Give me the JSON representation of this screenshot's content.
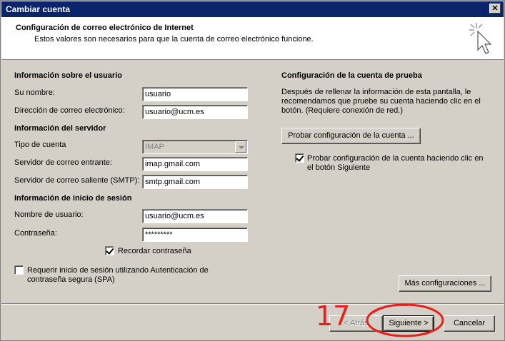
{
  "window": {
    "title": "Cambiar cuenta",
    "close_glyph": "✕"
  },
  "header": {
    "title": "Configuración de correo electrónico de Internet",
    "subtitle": "Estos valores son necesarios para que la cuenta de correo electrónico funcione.",
    "icon": "cursor-sparkle-icon"
  },
  "user_info": {
    "section": "Información sobre el usuario",
    "name_label": "Su nombre:",
    "name_value": "usuario",
    "email_label": "Dirección de correo electrónico:",
    "email_value": "usuario@ucm.es"
  },
  "server_info": {
    "section": "Información del servidor",
    "type_label": "Tipo de cuenta",
    "type_value": "IMAP",
    "incoming_label": "Servidor de correo entrante:",
    "incoming_value": "imap.gmail.com",
    "outgoing_label": "Servidor de correo saliente (SMTP):",
    "outgoing_value": "smtp.gmail.com"
  },
  "logon_info": {
    "section": "Información de inicio de sesión",
    "username_label": "Nombre de usuario:",
    "username_value": "usuario@ucm.es",
    "password_label": "Contraseña:",
    "password_value": "*********",
    "remember_label": "Recordar contraseña",
    "remember_checked": true,
    "spa_label_line1": "Requerir inicio de sesión utilizando Autenticación de",
    "spa_label_line2": "contraseña segura (SPA)",
    "spa_checked": false
  },
  "test_settings": {
    "section": "Configuración de la cuenta de prueba",
    "description": "Después de rellenar la información de esta pantalla, le recomendamos que pruebe su cuenta haciendo clic en el botón. (Requiere conexión de red.)",
    "test_button": "Probar configuración de la cuenta ...",
    "auto_test_line1": "Probar configuración de la cuenta haciendo clic en",
    "auto_test_line2": "el botón Siguiente",
    "auto_test_checked": true,
    "more_settings_button": "Más configuraciones ..."
  },
  "footer": {
    "back_button": "< Atrás",
    "next_button": "Siguiente >",
    "cancel_button": "Cancelar"
  },
  "annotation": {
    "step_number": "17",
    "color": "#e8201c"
  }
}
